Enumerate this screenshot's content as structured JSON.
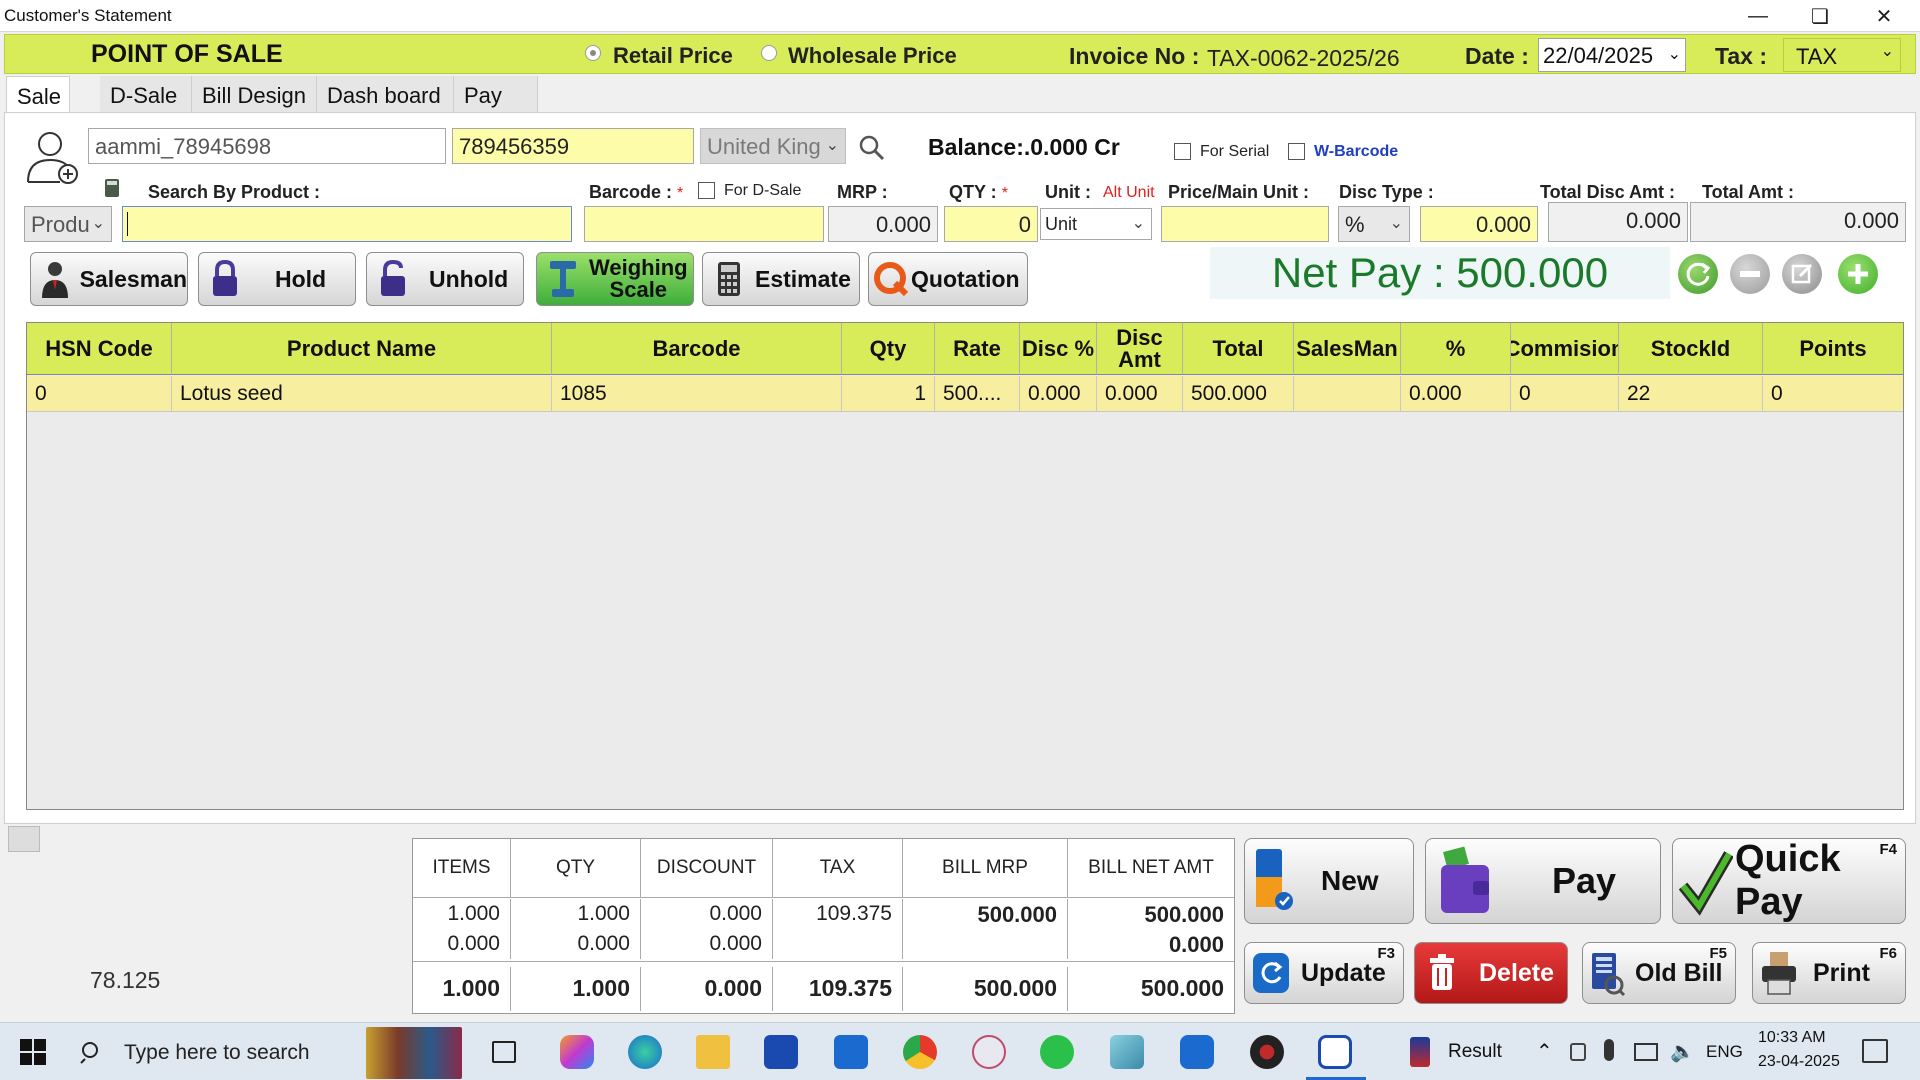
{
  "window": {
    "title": "Customer's Statement"
  },
  "header": {
    "title": "POINT OF SALE",
    "retail_price": "Retail Price",
    "wholesale_price": "Wholesale Price",
    "invoice_label": "Invoice No :",
    "invoice_value": "TAX-0062-2025/26",
    "date_label": "Date :",
    "date_value": "22/04/2025",
    "tax_label": "Tax :",
    "tax_value": "TAX"
  },
  "tabs": [
    "Sale",
    "D-Sale",
    "Bill Design",
    "Dash board",
    "Pay"
  ],
  "customer": {
    "name": "aammi_78945698",
    "phone": "789456359",
    "country": "United King",
    "balance": "Balance:.0.000 Cr",
    "for_serial": "For Serial",
    "w_barcode": "W-Barcode"
  },
  "entry": {
    "search_label": "Search By Product :",
    "search_mode": "Produ",
    "barcode_label": "Barcode :",
    "barcode_req": "*",
    "for_dsale": "For D-Sale",
    "mrp_label": "MRP :",
    "mrp_value": "0.000",
    "qty_label": "QTY :",
    "qty_req": "*",
    "qty_value": "0",
    "unit_label": "Unit :",
    "alt_unit": "Alt Unit",
    "unit_value": "Unit",
    "price_label": "Price/Main Unit :",
    "disc_type_label": "Disc Type :",
    "disc_type_value": "%",
    "disc_value": "0.000",
    "total_disc_label": "Total Disc Amt :",
    "total_disc_value": "0.000",
    "total_amt_label": "Total Amt :",
    "total_amt_value": "0.000"
  },
  "toolbar": {
    "salesman": "Salesman",
    "hold": "Hold",
    "unhold": "Unhold",
    "weighing": "Weighing\nScale",
    "estimate": "Estimate",
    "quotation": "Quotation",
    "net_pay": "Net Pay : 500.000"
  },
  "grid": {
    "headers": [
      "HSN Code",
      "Product Name",
      "Barcode",
      "Qty",
      "Rate",
      "Disc %",
      "Disc Amt",
      "Total",
      "SalesMan",
      "%",
      "Commision",
      "StockId",
      "Points"
    ],
    "rows": [
      [
        "0",
        "Lotus seed",
        "1085",
        "1",
        "500....",
        "0.000",
        "0.000",
        "500.000",
        "",
        "0.000",
        "0",
        "22",
        "0"
      ]
    ]
  },
  "footer": {
    "side_value": "78.125",
    "summary_headers": [
      "ITEMS",
      "QTY",
      "DISCOUNT",
      "TAX",
      "BILL MRP",
      "BILL NET AMT"
    ],
    "summary_rows": [
      [
        "1.000",
        "1.000",
        "0.000",
        "109.375",
        "500.000",
        "500.000"
      ],
      [
        "0.000",
        "0.000",
        "0.000",
        "",
        "",
        "0.000"
      ],
      [
        "1.000",
        "1.000",
        "0.000",
        "109.375",
        "500.000",
        "500.000"
      ]
    ],
    "buttons": {
      "new": "New",
      "pay": "Pay",
      "quick_pay": "Quick Pay",
      "quick_pay_key": "F4",
      "update": "Update",
      "update_key": "F3",
      "delete": "Delete",
      "old_bill": "Old Bill",
      "old_bill_key": "F5",
      "print": "Print",
      "print_key": "F6"
    }
  },
  "taskbar": {
    "search_placeholder": "Type here to search",
    "result": "Result",
    "lang": "ENG",
    "time": "10:33 AM",
    "date": "23-04-2025"
  },
  "colors": {
    "accent": "#d8ec5a",
    "row_highlight": "#f7eea0",
    "input_yellow": "#fdfca8",
    "net_pay_green": "#1a7a2a"
  }
}
